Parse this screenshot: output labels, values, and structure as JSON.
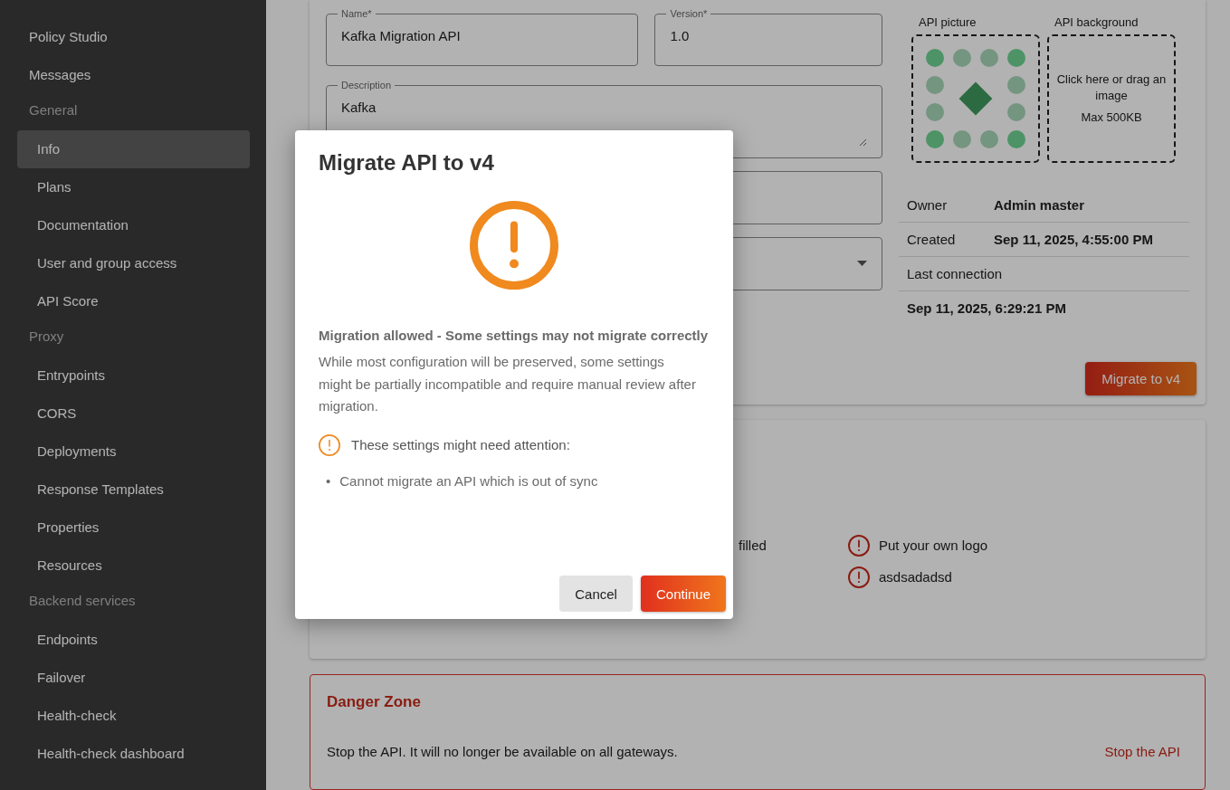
{
  "sidebar": {
    "top_items": [
      {
        "label": "Policy Studio",
        "selected": false
      },
      {
        "label": "Messages",
        "selected": false
      }
    ],
    "sections": [
      {
        "title": "General",
        "items": [
          {
            "label": "Info",
            "selected": true
          },
          {
            "label": "Plans",
            "selected": false
          },
          {
            "label": "Documentation",
            "selected": false
          },
          {
            "label": "User and group access",
            "selected": false
          },
          {
            "label": "API Score",
            "selected": false
          }
        ]
      },
      {
        "title": "Proxy",
        "items": [
          {
            "label": "Entrypoints",
            "selected": false
          },
          {
            "label": "CORS",
            "selected": false
          },
          {
            "label": "Deployments",
            "selected": false
          },
          {
            "label": "Response Templates",
            "selected": false
          },
          {
            "label": "Properties",
            "selected": false
          },
          {
            "label": "Resources",
            "selected": false
          }
        ]
      },
      {
        "title": "Backend services",
        "items": [
          {
            "label": "Endpoints",
            "selected": false
          },
          {
            "label": "Failover",
            "selected": false
          },
          {
            "label": "Health-check",
            "selected": false
          },
          {
            "label": "Health-check dashboard",
            "selected": false
          }
        ]
      }
    ]
  },
  "general_card": {
    "name_field": {
      "label": "Name*",
      "value": "Kafka Migration API"
    },
    "version_field": {
      "label": "Version*",
      "value": "1.0"
    },
    "description_field": {
      "label": "Description",
      "value": "Kafka"
    },
    "api_picture": {
      "label": "API picture"
    },
    "api_background": {
      "label": "API background",
      "hint": "Click here or drag an image",
      "limit": "Max 500KB"
    },
    "details": [
      {
        "label": "Owner",
        "value": "Admin master"
      },
      {
        "label": "Created",
        "value": "Sep 11, 2025, 4:55:00 PM"
      },
      {
        "label": "Last connection",
        "value": "Sep 11, 2025, 6:29:21 PM"
      }
    ],
    "migrate_button": "Migrate to v4"
  },
  "quality_card": {
    "left_items": [
      "filled"
    ],
    "right_items": [
      "Put your own logo",
      "asdsadadsd"
    ]
  },
  "danger_zone": {
    "title": "Danger Zone",
    "text": "Stop the API. It will no longer be available on all gateways.",
    "action": "Stop the API"
  },
  "dialog": {
    "title": "Migrate API to v4",
    "heading": "Migration allowed - Some settings may not migrate correctly",
    "body": "While most configuration will be preserved, some settings might be partially incompatible and require manual review after migration.",
    "attention": "These settings might need attention:",
    "issues": [
      {
        "bullet": "•",
        "text": "Cannot migrate an API which is out of sync"
      }
    ],
    "buttons": [
      {
        "label": "Cancel",
        "kind": "secondary"
      },
      {
        "label": "Continue",
        "kind": "primary"
      }
    ]
  }
}
